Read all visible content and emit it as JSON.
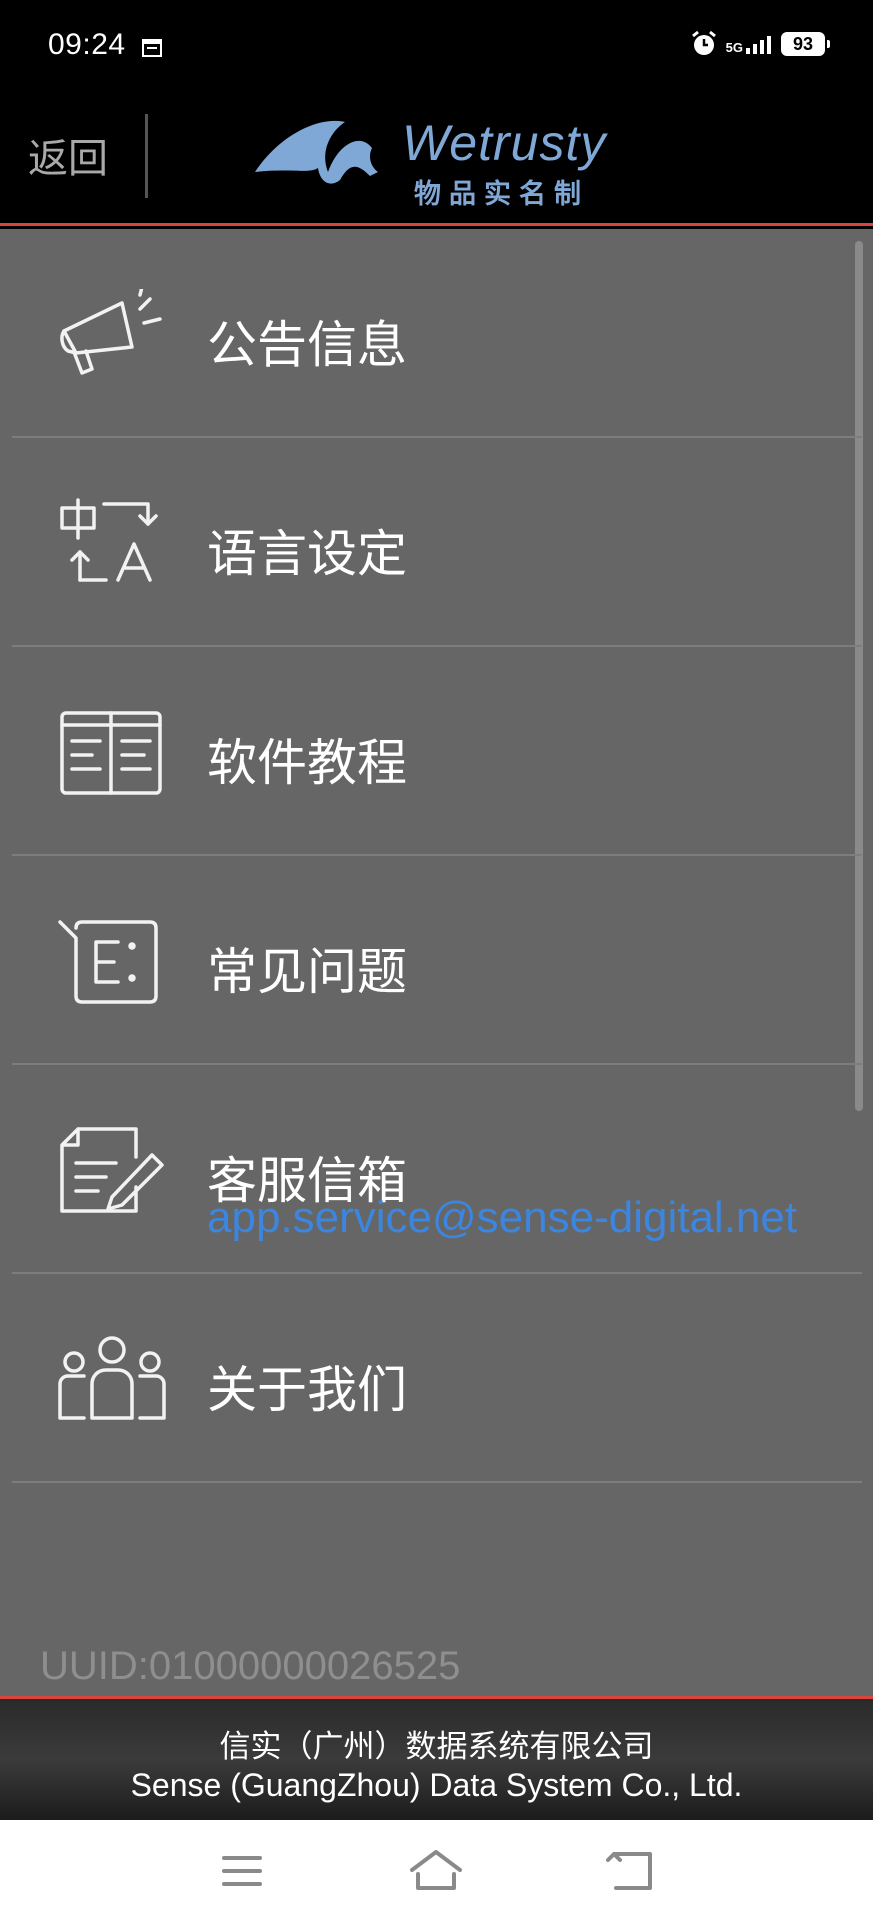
{
  "status_bar": {
    "time": "09:24",
    "network": "5G",
    "battery": "93"
  },
  "header": {
    "back_label": "返回",
    "logo_text": "Wetrusty",
    "logo_subtitle": "物品实名制"
  },
  "menu": {
    "items": [
      {
        "label": "公告信息",
        "icon": "megaphone-icon"
      },
      {
        "label": "语言设定",
        "icon": "language-switch-icon"
      },
      {
        "label": "软件教程",
        "icon": "book-icon"
      },
      {
        "label": "常见问题",
        "icon": "faq-icon"
      },
      {
        "label": "客服信箱",
        "icon": "edit-document-icon",
        "email": "app.service@sense-digital.net"
      },
      {
        "label": "关于我们",
        "icon": "group-icon"
      }
    ]
  },
  "uuid": "UUID:01000000026525",
  "footer": {
    "company_cn": "信实（广州）数据系统有限公司",
    "company_en": "Sense (GuangZhou) Data System Co., Ltd."
  },
  "colors": {
    "accent_red": "#d9443c",
    "logo_blue": "#7fa8d6",
    "email_blue": "#3a86e0",
    "panel_gray": "#666666"
  }
}
